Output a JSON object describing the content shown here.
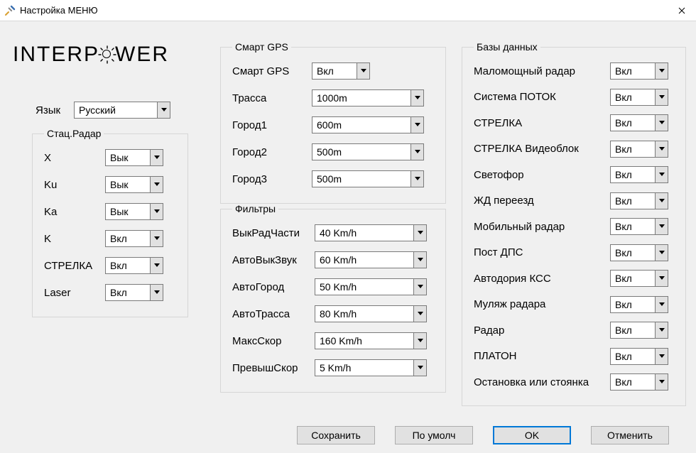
{
  "window": {
    "title": "Настройка МЕНЮ"
  },
  "logo": {
    "part1": "INTERP",
    "part2": "WER"
  },
  "lang": {
    "label": "Язык",
    "value": "Русский"
  },
  "groups": {
    "radar": {
      "legend": "Стац.Радар",
      "rows": [
        {
          "label": "X",
          "value": "Вык"
        },
        {
          "label": "Ku",
          "value": "Вык"
        },
        {
          "label": "Ka",
          "value": "Вык"
        },
        {
          "label": "K",
          "value": "Вкл"
        },
        {
          "label": "СТРЕЛКА",
          "value": "Вкл"
        },
        {
          "label": "Laser",
          "value": "Вкл"
        }
      ]
    },
    "gps": {
      "legend": "Смарт GPS",
      "rows": [
        {
          "label": "Смарт GPS",
          "value": "Вкл",
          "w": "narrow"
        },
        {
          "label": "Трасса",
          "value": "1000m",
          "w": "wide"
        },
        {
          "label": "Город1",
          "value": "600m",
          "w": "wide"
        },
        {
          "label": "Город2",
          "value": "500m",
          "w": "wide"
        },
        {
          "label": "Город3",
          "value": "500m",
          "w": "wide"
        }
      ]
    },
    "filters": {
      "legend": "Фильтры",
      "rows": [
        {
          "label": "ВыкРадЧасти",
          "value": "40 Km/h"
        },
        {
          "label": "АвтоВыкЗвук",
          "value": "60 Km/h"
        },
        {
          "label": "АвтоГород",
          "value": "50 Km/h"
        },
        {
          "label": "АвтоТрасса",
          "value": "80 Km/h"
        },
        {
          "label": "МаксСкор",
          "value": "160 Km/h"
        },
        {
          "label": "ПревышСкор",
          "value": "5 Km/h"
        }
      ]
    },
    "db": {
      "legend": "Базы данных",
      "rows": [
        {
          "label": "Маломощный радар",
          "value": "Вкл"
        },
        {
          "label": "Система ПОТОК",
          "value": "Вкл"
        },
        {
          "label": "СТРЕЛКА",
          "value": "Вкл"
        },
        {
          "label": "СТРЕЛКА Видеоблок",
          "value": "Вкл"
        },
        {
          "label": "Светофор",
          "value": "Вкл"
        },
        {
          "label": "ЖД переезд",
          "value": "Вкл"
        },
        {
          "label": "Мобильный радар",
          "value": "Вкл"
        },
        {
          "label": "Пост ДПС",
          "value": "Вкл"
        },
        {
          "label": "Автодория КСС",
          "value": "Вкл"
        },
        {
          "label": "Муляж радара",
          "value": "Вкл"
        },
        {
          "label": "Радар",
          "value": "Вкл"
        },
        {
          "label": "ПЛАТОН",
          "value": "Вкл"
        },
        {
          "label": "Остановка или стоянка",
          "value": "Вкл"
        }
      ]
    }
  },
  "buttons": {
    "save": "Сохранить",
    "defaults": "По умолч",
    "ok": "OK",
    "cancel": "Отменить"
  }
}
